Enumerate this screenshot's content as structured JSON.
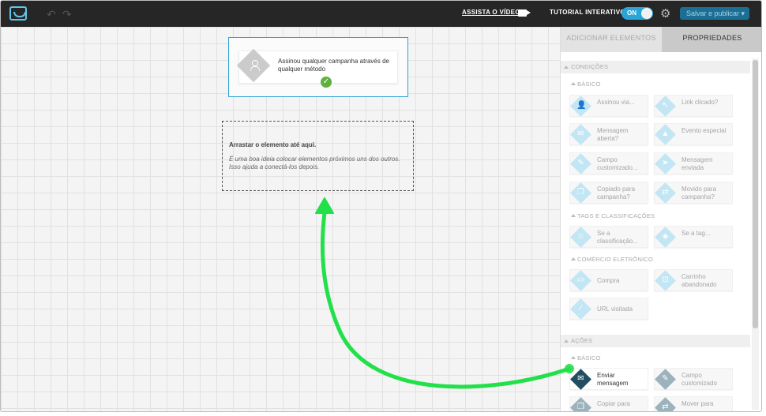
{
  "topbar": {
    "watch_video": "ASSISTA O VÍDEO",
    "tutorial": "TUTORIAL INTERATIVO",
    "toggle": "ON",
    "save": "Salvar e publicar ▾"
  },
  "canvas": {
    "start_text": "Assinou qualquer campanha através de qualquer método",
    "drop_title": "Arrastar o elemento até aqui.",
    "drop_desc": "É uma boa ideia colocar elementos próximos uns dos outros. Isso ajuda a conectá-los depois."
  },
  "panel": {
    "tab_add": "ADICIONAR ELEMENTOS",
    "tab_props": "PROPRIEDADES",
    "sections": {
      "conditions": "CONDIÇÕES",
      "basic": "BÁSICO",
      "tags": "TAGS E CLASSIFICAÇÕES",
      "ecommerce": "COMÉRCIO ELETRÔNICO",
      "actions": "AÇÕES",
      "actions_basic": "BÁSICO"
    },
    "items": {
      "assinou": "Assinou via...",
      "link": "Link clicado?",
      "mensagem_aberta": "Mensagem aberta?",
      "evento": "Evento especial",
      "campo": "Campo customizado...",
      "mensagem_enviada": "Mensagem enviada",
      "copiado": "Copiado para campanha?",
      "movido": "Movido para campanha?",
      "classificacao": "Se a classificação...",
      "tag": "Se a tag...",
      "compra": "Compra",
      "carrinho": "Carrinho abandonado",
      "url": "URL visitada",
      "enviar": "Enviar mensagem",
      "campo_acao": "Campo customizado",
      "copiar": "Copiar para",
      "mover": "Mover para"
    }
  },
  "colors": {
    "accent": "#2aa5d8",
    "arrow": "#22e04a",
    "check": "#5eb13a"
  }
}
